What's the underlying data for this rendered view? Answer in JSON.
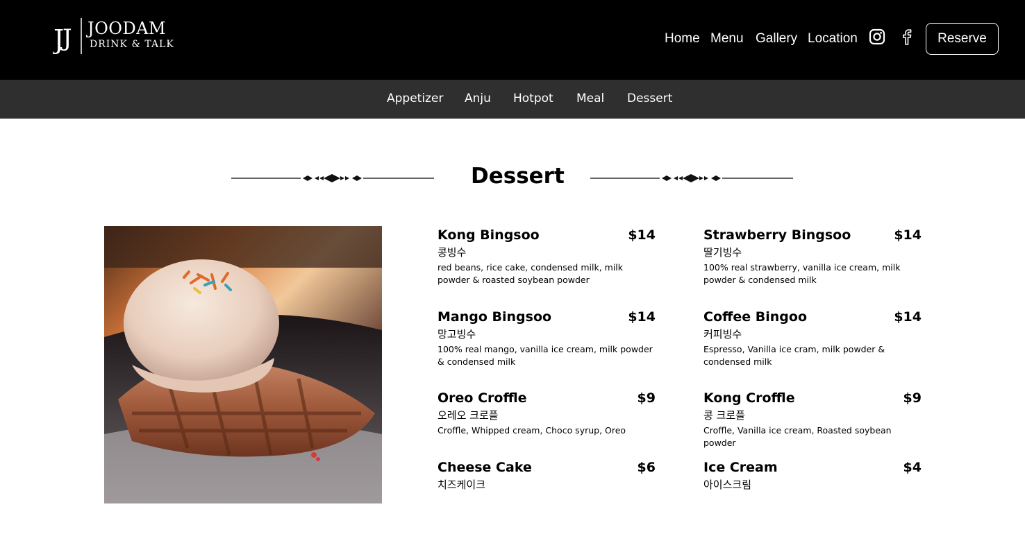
{
  "brand": {
    "mark": "JJ",
    "title": "JOODAM",
    "subtitle": "DRINK & TALK"
  },
  "nav": {
    "home": "Home",
    "menu": "Menu",
    "gallery": "Gallery",
    "location": "Location",
    "instagram_icon": "instagram-icon",
    "facebook_icon": "facebook-icon",
    "reserve": "Reserve"
  },
  "categories": [
    "Appetizer",
    "Anju",
    "Hotpot",
    "Meal",
    "Dessert"
  ],
  "section": {
    "title": "Dessert"
  },
  "items": [
    {
      "name": "Kong Bingsoo",
      "price": "$14",
      "korean": "콩빙수",
      "description": "red beans, rice cake, condensed milk, milk powder & roasted soybean powder"
    },
    {
      "name": "Strawberry Bingsoo",
      "price": "$14",
      "korean": "딸기빙수",
      "description": "100% real strawberry, vanilla ice cream, milk powder & condensed milk"
    },
    {
      "name": "Mango Bingsoo",
      "price": "$14",
      "korean": "망고빙수",
      "description": "100% real mango, vanilla ice cream, milk powder & condensed milk"
    },
    {
      "name": "Coffee Bingoo",
      "price": "$14",
      "korean": "커피빙수",
      "description": "Espresso, Vanilla ice cram, milk powder & condensed milk"
    },
    {
      "name": "Oreo Croffle",
      "price": "$9",
      "korean": "오레오 크로플",
      "description": "Croffle, Whipped cream, Choco syrup, Oreo"
    },
    {
      "name": "Kong Croffle",
      "price": "$9",
      "korean": "콩 크로플",
      "description": "Croffle, Vanilla ice cream, Roasted soybean powder"
    },
    {
      "name": "Cheese Cake",
      "price": "$6",
      "korean": "치즈케이크",
      "description": ""
    },
    {
      "name": "Ice Cream",
      "price": "$4",
      "korean": "아이스크림",
      "description": ""
    }
  ],
  "colors": {
    "header_bg": "#000000",
    "category_bar_bg": "#2f2f2f",
    "text": "#000000",
    "nav_text": "#ffffff"
  }
}
